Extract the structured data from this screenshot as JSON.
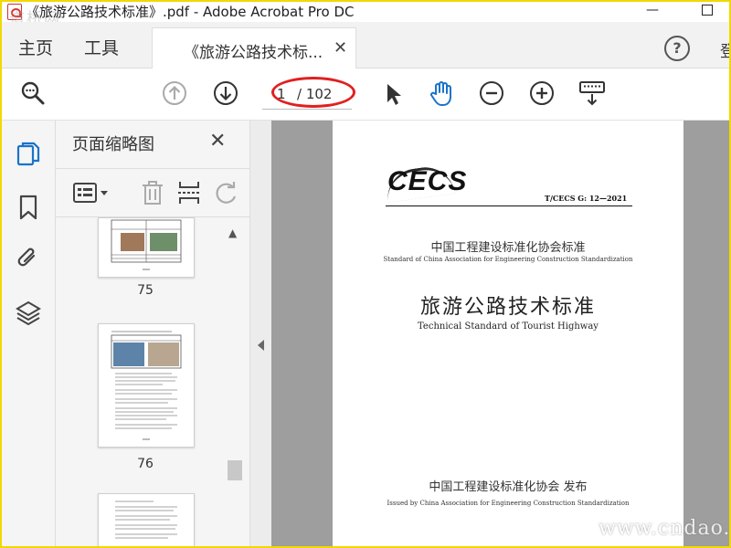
{
  "window": {
    "title": "《旅游公路技术标准》.pdf - Adobe Acrobat Pro DC",
    "watermark_top": "道桥网",
    "min_glyph": "—"
  },
  "menu": {
    "home": "主页",
    "tools": "工具",
    "doc_tab": "《旅游公路技术标...",
    "close_glyph": "✕",
    "help_glyph": "?",
    "signin_clip": "登"
  },
  "toolbar": {
    "current_page": "1",
    "total_pages": "/ 102",
    "icons": [
      "search-icon",
      "prev-page-icon",
      "next-page-icon",
      "select-cursor-icon",
      "hand-tool-icon",
      "zoom-out-icon",
      "zoom-in-icon",
      "keyboard-icon"
    ],
    "accent_color": "#1a73c8",
    "highlight_color": "#e02020"
  },
  "sidebar": {
    "icons": [
      "page-thumbnails-icon",
      "bookmarks-icon",
      "attachments-icon",
      "layers-icon"
    ]
  },
  "thumbnails": {
    "title": "页面缩略图",
    "close_glyph": "✕",
    "tool_icons": [
      "options-icon",
      "delete-icon",
      "insert-page-icon",
      "rotate-icon"
    ],
    "pages": [
      {
        "label": "75"
      },
      {
        "label": "76"
      },
      {
        "label": ""
      }
    ]
  },
  "document": {
    "logo": "CECS",
    "std_code": "T/CECS G: 12—2021",
    "assoc_cn": "中国工程建设标准化协会标准",
    "assoc_en": "Standard of China Association for Engineering Construction Standardization",
    "title_cn": "旅游公路技术标准",
    "title_en": "Technical Standard of Tourist Highway",
    "issued_cn": "中国工程建设标准化协会  发布",
    "issued_en": "Issued by China Association for Engineering Construction Standardization"
  },
  "watermark_br": "www.cndao."
}
